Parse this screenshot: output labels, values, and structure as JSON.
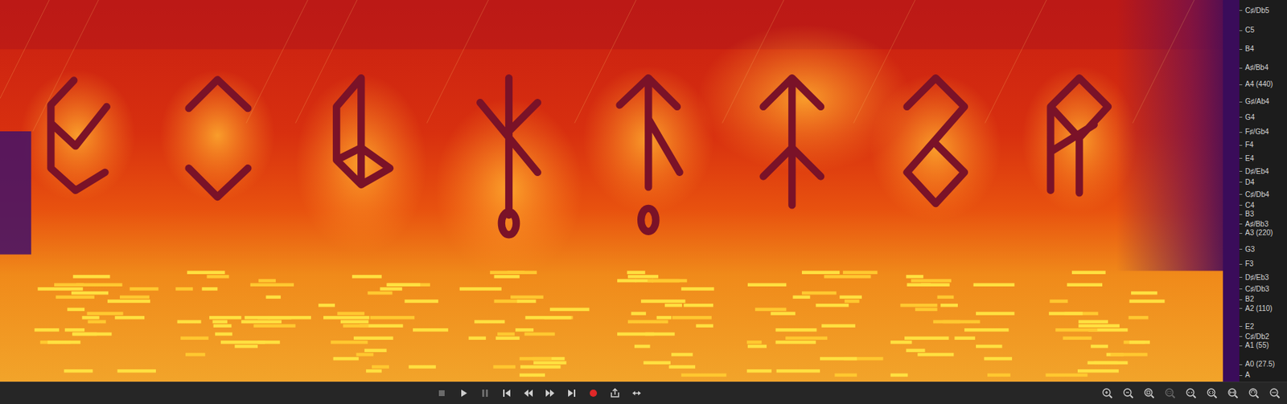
{
  "spectrogram": {
    "frequency_axis": {
      "labels": [
        "C♯/Db5",
        "C5",
        "B4",
        "A♯/Bb4",
        "A4 (440)",
        "G♯/Ab4",
        "G4",
        "F♯/Gb4",
        "F4",
        "E4",
        "D♯/Eb4",
        "D4",
        "C♯/Db4",
        "C4",
        "B3",
        "A♯/Bb3",
        "A3 (220)",
        "G3",
        "F3",
        "D♯/Eb3",
        "C♯/Db3",
        "B2",
        "A2 (110)",
        "E2",
        "C♯/Db2",
        "A1 (55)",
        "A0 (27.5)",
        "A"
      ]
    }
  },
  "toolbar": {
    "transport": [
      {
        "kind": "stop",
        "disabled": true
      },
      {
        "kind": "play",
        "disabled": false
      },
      {
        "kind": "pause",
        "disabled": true
      },
      {
        "kind": "start",
        "disabled": false
      },
      {
        "kind": "rewind",
        "disabled": false
      },
      {
        "kind": "forward",
        "disabled": false
      },
      {
        "kind": "end",
        "disabled": false
      },
      {
        "kind": "record",
        "disabled": false
      },
      {
        "kind": "export",
        "disabled": false
      },
      {
        "kind": "loop",
        "disabled": false
      }
    ],
    "zoom": [
      {
        "kind": "plus",
        "disabled": false
      },
      {
        "kind": "minus",
        "disabled": false
      },
      {
        "kind": "fit",
        "disabled": false
      },
      {
        "kind": "selection",
        "disabled": true
      },
      {
        "kind": "narrow",
        "disabled": false
      },
      {
        "kind": "widen",
        "disabled": false
      },
      {
        "kind": "span",
        "disabled": false
      },
      {
        "kind": "rotate",
        "disabled": false
      },
      {
        "kind": "more",
        "disabled": false
      }
    ]
  }
}
